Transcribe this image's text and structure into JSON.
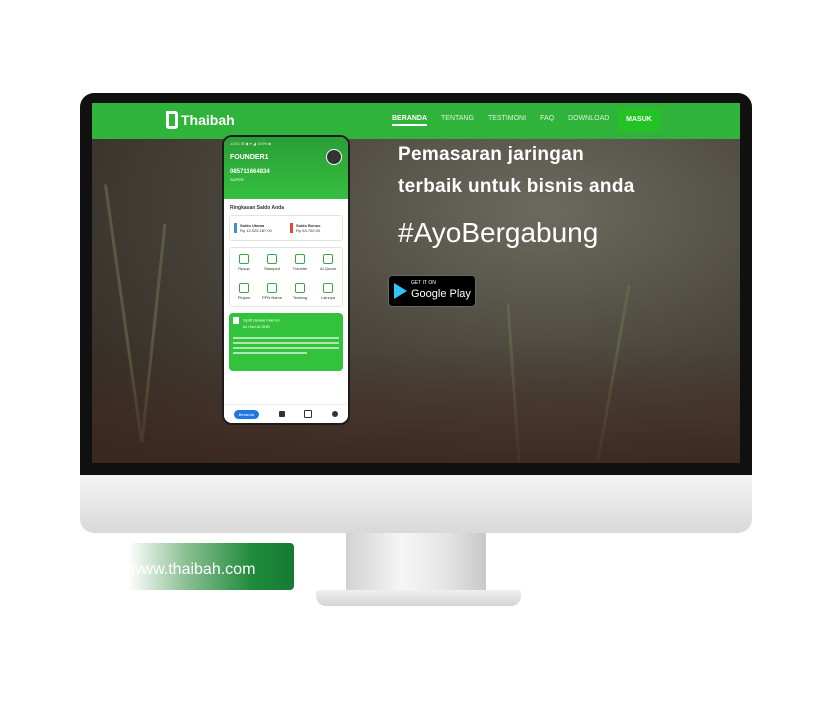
{
  "nav": {
    "logo_text": "Thaibah",
    "menu": [
      "BERANDA",
      "TENTANG",
      "TESTIMONI",
      "FAQ",
      "DOWNLOAD"
    ],
    "login_label": "MASUK"
  },
  "phone": {
    "status": "12:51 ⊞ ◆              ▾ ◢ 100% ■",
    "name": "FOUNDER1",
    "phone_number": "085711664834",
    "sub": "SUPER",
    "section_title": "Ringkasan Saldo Anda",
    "saldo": [
      {
        "label": "Saldo Utama",
        "value": "Rp 12.025.187,00"
      },
      {
        "label": "Saldo Bonus",
        "value": "Rp 64.700,00"
      }
    ],
    "menu": [
      "Rpsup",
      "Stamped",
      "Transfer",
      "Al-Quran",
      "Pinjam",
      "PPN Name",
      "Tentang",
      "Lainnya"
    ],
    "card_title": "Spirit dahaan hari ini",
    "card_sub": "Ini Hari ALSHD",
    "nav_home": "Beranda"
  },
  "hero": {
    "line1": "Pemasaran jaringan",
    "line2": "terbaik untuk bisnis anda",
    "hashtag": "#AyoBergabung"
  },
  "google_play": {
    "small": "GET IT ON",
    "big": "Google Play"
  },
  "url": "www.thaibah.com",
  "colors": {
    "primary_green": "#2fb33a",
    "button_green": "#22c322",
    "url_badge_green": "#1f8a3b"
  }
}
